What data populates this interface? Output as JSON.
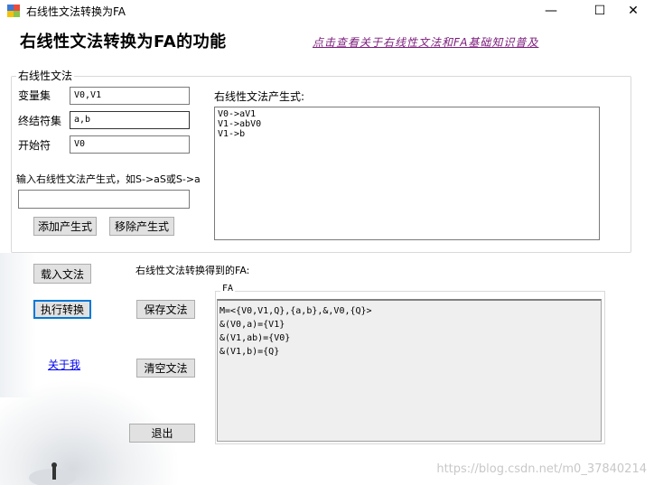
{
  "window": {
    "title": "右线性文法转换为FA",
    "minimize": "—",
    "maximize": "☐",
    "close": "✕"
  },
  "header": {
    "title": "右线性文法转换为FA的功能",
    "link": "点击查看关于右线性文法和FA基础知识普及"
  },
  "grammar": {
    "group_label": "右线性文法",
    "variables_label": "变量集",
    "variables_value": "V0,V1",
    "terminals_label": "终结符集",
    "terminals_value": "a,b",
    "start_label": "开始符",
    "start_value": "V0",
    "input_hint": "输入右线性文法产生式，如S->aS或S->a",
    "input_value": "",
    "add_button": "添加产生式",
    "remove_button": "移除产生式",
    "productions_label": "右线性文法产生式:",
    "productions": [
      "V0->aV1",
      "V1->abV0",
      "V1->b"
    ]
  },
  "actions": {
    "load_button": "载入文法",
    "execute_button": "执行转换",
    "about_link": "关于我",
    "save_button": "保存文法",
    "clear_button": "清空文法",
    "exit_button": "退出"
  },
  "result": {
    "label": "右线性文法转换得到的FA:",
    "fa_legend": "FA",
    "lines": [
      "M=<{V0,V1,Q},{a,b},&,V0,{Q}>",
      "&(V0,a)={V1}",
      "&(V1,ab)={V0}",
      "&(V1,b)={Q}"
    ]
  },
  "watermark": "https://blog.csdn.net/m0_37840214",
  "colors": {
    "accent": "#0078d7",
    "link_purple": "#7a1a7a",
    "button_face": "#e1e1e1"
  }
}
